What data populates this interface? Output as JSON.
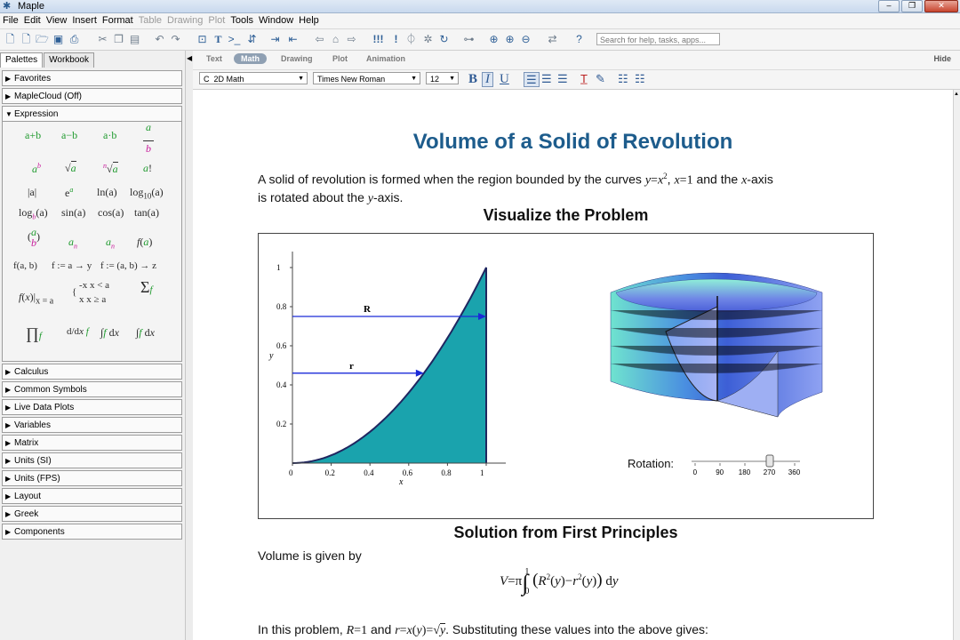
{
  "window": {
    "title": "Maple"
  },
  "menu": [
    "File",
    "Edit",
    "View",
    "Insert",
    "Format",
    "Table",
    "Drawing",
    "Plot",
    "Tools",
    "Window",
    "Help"
  ],
  "menu_disabled": [
    "Table",
    "Drawing",
    "Plot"
  ],
  "toolbar": {
    "search_placeholder": "Search for help, tasks, apps..."
  },
  "left_panel": {
    "tabs": [
      "Palettes",
      "Workbook"
    ],
    "sections_top": [
      "Favorites",
      "MapleCloud (Off)"
    ],
    "expanded_section": "Expression",
    "sections_bottom": [
      "Calculus",
      "Common Symbols",
      "Live Data Plots",
      "Variables",
      "Matrix",
      "Units (SI)",
      "Units (FPS)",
      "Layout",
      "Greek",
      "Components"
    ],
    "expression": {
      "row1": [
        "a+b",
        "a−b",
        "a·b"
      ],
      "row3": [
        "|a|",
        "e",
        "ln(a)",
        "log",
        "(a)"
      ],
      "row4": [
        "log",
        "(a)",
        "sin(a)",
        "cos(a)",
        "tan(a)"
      ],
      "row6": [
        "f(a, b)",
        "f := a → y",
        "f := (a, b) → z"
      ],
      "piecewise": [
        "-x  x < a",
        "x  x ≥ a"
      ],
      "x_eq_a": "x = a"
    }
  },
  "doc_toolbar": {
    "modes": [
      "Text",
      "Math",
      "Drawing",
      "Plot",
      "Animation"
    ],
    "active_mode": "Math",
    "hide": "Hide"
  },
  "format_toolbar": {
    "input_mode": "2D Math",
    "font": "Times New Roman",
    "size": "12",
    "prefix_c": "C"
  },
  "document": {
    "title": "Volume of a Solid of Revolution",
    "intro_a": "A solid of revolution is formed when the region bounded by the curves",
    "intro_b": "and the",
    "intro_c": "-axis",
    "intro_d": "is rotated about the",
    "intro_e": "-axis.",
    "h_visualize": "Visualize the Problem",
    "h_solution": "Solution from First Principles",
    "volume_text": "Volume is given by",
    "problem_a": "In this problem,",
    "problem_b": "and",
    "problem_c": ". Substituting these values into the above gives:",
    "rotation_label": "Rotation:"
  },
  "plot": {
    "x_ticks": [
      "0",
      "0.2",
      "0.4",
      "0.6",
      "0.8",
      "1"
    ],
    "y_ticks": [
      "0.2",
      "0.4",
      "0.6",
      "0.8",
      "1"
    ],
    "xlabel": "x",
    "ylabel": "y",
    "R_label": "R",
    "r_label": "r",
    "fill_color": "#1aa3ad"
  },
  "slider": {
    "ticks": [
      "0",
      "90",
      "180",
      "270",
      "360"
    ],
    "value": 270
  }
}
